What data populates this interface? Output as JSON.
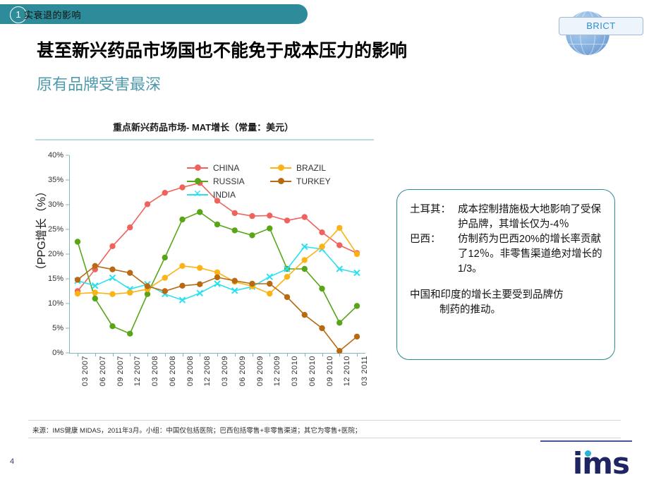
{
  "header": {
    "badge_number": "1",
    "bar_text": "实衰退的影响",
    "brict_label": "BRICT",
    "globe_icon": "globe-icon"
  },
  "slide": {
    "title": "甚至新兴药品市场国也不能免于成本压力的影响",
    "subtitle": "原有品牌受害最深"
  },
  "textbox": {
    "rows": [
      {
        "key": "土耳其：",
        "value": "成本控制措施极大地影响了受保护品牌，其增长仅为-4％"
      },
      {
        "key": "巴西：",
        "value": "仿制药为巴西20%的增长率贡献了12％。非零售渠道绝对增长的1/3。"
      }
    ],
    "paragraph_line1": "中国和印度的增长主要受到品牌仿",
    "paragraph_line2": "制药的推动。"
  },
  "footer": {
    "source": "来源：IMS健康 MIDAS，2011年3月。小组：中国仅包括医院；巴西包括零售+非零售渠道；其它为零售+医院；",
    "page_number": "4",
    "logo_text": "ims"
  },
  "chart_data": {
    "type": "line",
    "title": "重点新兴药品市场- MAT增长（常量：美元）",
    "xlabel": "",
    "ylabel": "（PPG增长（%）",
    "ylim": [
      0,
      40
    ],
    "ytick_labels": [
      "0%",
      "5%",
      "10%",
      "15%",
      "20%",
      "25%",
      "30%",
      "35%",
      "40%"
    ],
    "ytick_values": [
      0,
      5,
      10,
      15,
      20,
      25,
      30,
      35,
      40
    ],
    "grid": false,
    "legend_position": "inside-top-right",
    "categories": [
      "03 2007",
      "06 2007",
      "09 2007",
      "12 2007",
      "03 2008",
      "06 2008",
      "09 2008",
      "12 2008",
      "03 2009",
      "06 2009",
      "09 2009",
      "12 2009",
      "03 2010",
      "06 2010",
      "09 2010",
      "12 2010",
      "03 2011"
    ],
    "series": [
      {
        "name": "CHINA",
        "color": "#f0635c",
        "marker": "circle",
        "values": [
          12.5,
          16.9,
          21.6,
          25.4,
          30.1,
          32.4,
          33.5,
          34.4,
          30.8,
          28.3,
          27.7,
          27.8,
          26.8,
          27.5,
          24.4,
          21.8,
          20.2
        ]
      },
      {
        "name": "RUSSIA",
        "color": "#58a617",
        "marker": "circle",
        "values": [
          22.5,
          11.0,
          5.4,
          3.9,
          11.9,
          19.3,
          27.0,
          28.5,
          26.0,
          24.8,
          23.8,
          25.2,
          17.0,
          17.0,
          13.0,
          6.1,
          9.5
        ]
      },
      {
        "name": "INDIA",
        "color": "#2ce0f0",
        "marker": "x",
        "values": [
          14.6,
          13.6,
          15.2,
          12.9,
          13.9,
          11.9,
          10.7,
          12.1,
          14.0,
          12.6,
          13.4,
          15.4,
          17.0,
          21.5,
          21.0,
          17.0,
          16.2
        ]
      },
      {
        "name": "BRAZIL",
        "color": "#fbb316",
        "marker": "circle",
        "values": [
          12.0,
          12.2,
          11.9,
          12.2,
          12.9,
          15.2,
          17.6,
          17.2,
          16.3,
          14.4,
          13.5,
          12.0,
          15.4,
          18.8,
          21.5,
          25.3,
          20.0
        ]
      },
      {
        "name": "TURKEY",
        "color": "#b86a12",
        "marker": "circle",
        "values": [
          14.8,
          17.6,
          16.9,
          16.2,
          13.5,
          12.5,
          13.6,
          13.9,
          15.3,
          14.6,
          14.0,
          14.0,
          11.3,
          7.7,
          5.0,
          0.4,
          3.3
        ]
      }
    ]
  }
}
